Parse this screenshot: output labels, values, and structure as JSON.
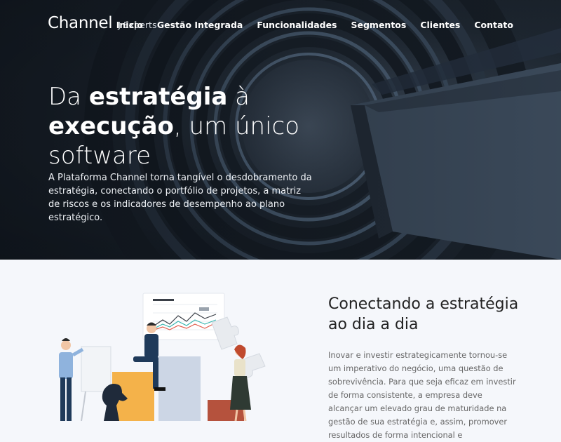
{
  "header": {
    "logo_main": "Channel",
    "logo_sub": "J Experts",
    "menu": [
      "Inicio",
      "Gestão Integrada",
      "Funcionalidades",
      "Segmentos",
      "Clientes",
      "Contato"
    ]
  },
  "hero": {
    "headline_1": "Da ",
    "headline_bold_1": "estratégia",
    "headline_2": " à",
    "headline_bold_2": "execução",
    "headline_3": ", um único",
    "headline_4": "software",
    "lead": "A Plataforma Channel torna tangível o desdobramento da estratégia, conectando o portfólio de projetos, a matriz de riscos e os indicadores de desempenho ao plano estratégico."
  },
  "section": {
    "title": "Conectando a estratégia ao dia a dia",
    "text": "Inovar e investir estrategicamente tornou-se um imperativo do negócio, uma questão de sobrevivência. Para que seja eficaz em investir de forma consistente, a empresa deve alcançar um elevado grau de maturidade na gestão de sua estratégia e, assim, promover resultados de forma intencional e"
  },
  "colors": {
    "hero_dark": "#1f2832",
    "accent_orange": "#f4b24a",
    "accent_teal": "#39b6b0",
    "accent_red": "#e05a4a",
    "navy": "#1f3a5a"
  }
}
